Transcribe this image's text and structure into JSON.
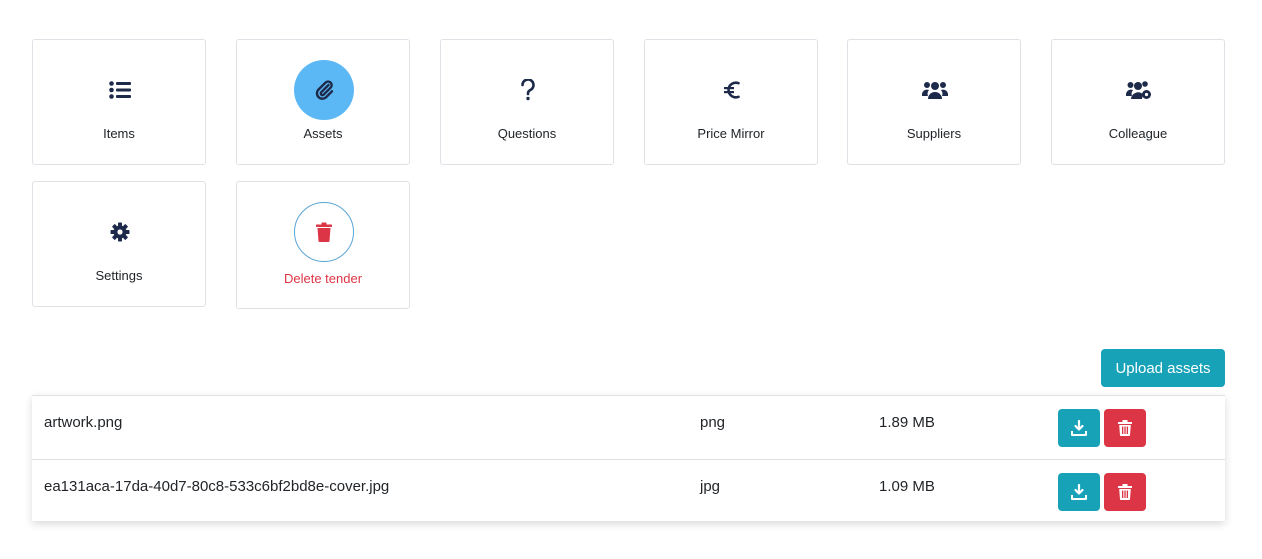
{
  "tiles": {
    "items": {
      "label": "Items",
      "icon": "list-icon"
    },
    "assets": {
      "label": "Assets",
      "icon": "paperclip-icon"
    },
    "questions": {
      "label": "Questions",
      "icon": "question-icon"
    },
    "price_mirror": {
      "label": "Price Mirror",
      "icon": "euro-icon"
    },
    "suppliers": {
      "label": "Suppliers",
      "icon": "users-icon"
    },
    "colleague": {
      "label": "Colleague",
      "icon": "users-gear-icon"
    },
    "settings": {
      "label": "Settings",
      "icon": "gear-icon"
    },
    "delete_tender": {
      "label": "Delete tender",
      "icon": "trash-icon"
    }
  },
  "assets": {
    "upload_label": "Upload assets",
    "rows": [
      {
        "name": "artwork.png",
        "type": "png",
        "size": "1.89 MB"
      },
      {
        "name": "ea131aca-17da-40d7-80c8-533c6bf2bd8e-cover.jpg",
        "type": "jpg",
        "size": "1.09 MB"
      }
    ]
  },
  "colors": {
    "icon_dark": "#1e2a4a",
    "active_circle": "#5bb8f5",
    "teal": "#17a2b8",
    "danger": "#dc3545"
  }
}
